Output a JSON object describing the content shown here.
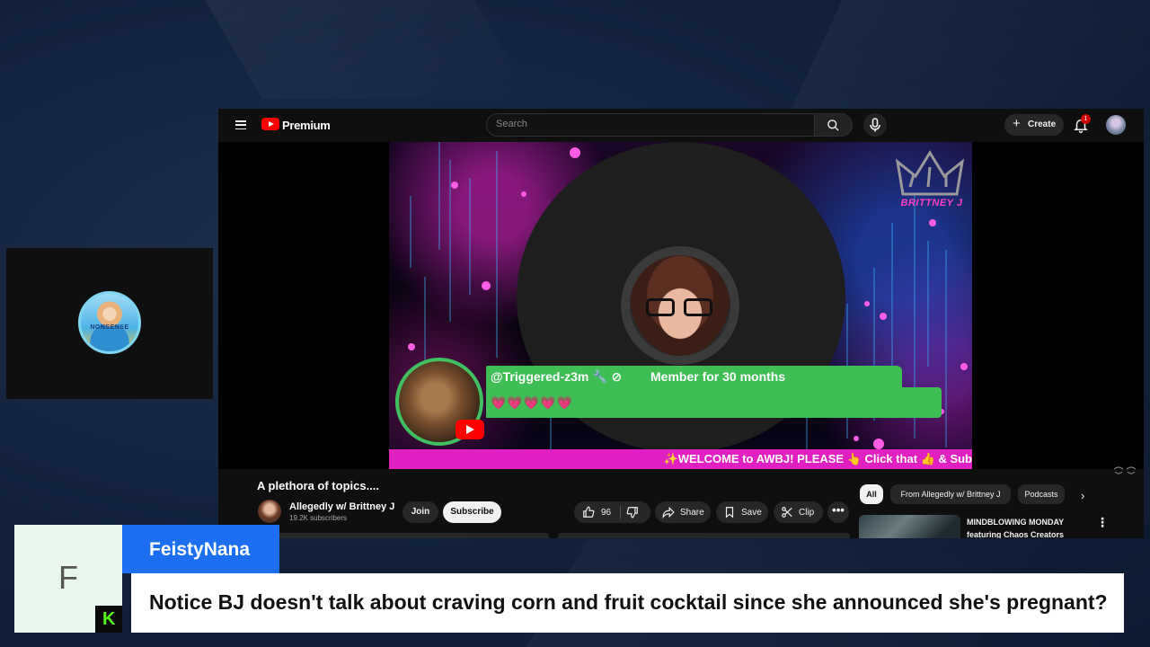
{
  "youtube": {
    "brand": "Premium",
    "search_placeholder": "Search",
    "create_label": "Create",
    "notification_count": "1"
  },
  "stream_overlay": {
    "brand_text": "BRITTNEY J",
    "alert_username": "@Triggered-z3m 🔧 ⊘",
    "alert_member": "Member for 30 months",
    "alert_hearts": "💗💗💗💗💗",
    "ticker_text": "✨WELCOME to AWBJ! PLEASE 👆 Click that 👍 & Sub"
  },
  "video": {
    "title": "A plethora of topics....",
    "channel_name": "Allegedly w/ Brittney J",
    "subscribers": "19.2K subscribers",
    "join_label": "Join",
    "subscribe_label": "Subscribe",
    "like_count": "96",
    "share_label": "Share",
    "save_label": "Save",
    "clip_label": "Clip",
    "more_label": "•••"
  },
  "recommendations": {
    "chips": [
      "All",
      "From Allegedly w/ Brittney J",
      "Podcasts"
    ],
    "items": [
      {
        "title_line1": "MINDBLOWING MONDAY",
        "title_line2": "featuring Chaos Creators"
      }
    ]
  },
  "chat_overlay": {
    "letter": "F",
    "platform_badge": "K",
    "username": "FeistyNana",
    "message": "Notice BJ doesn't talk about craving corn and fruit cocktail since she announced she's pregnant?"
  },
  "colors": {
    "name_tag": "#1c6ff0",
    "kick_green": "#53fc18",
    "alert_green": "#3fbe55",
    "ticker_magenta": "#e020c0",
    "youtube_red": "#ff0000"
  }
}
